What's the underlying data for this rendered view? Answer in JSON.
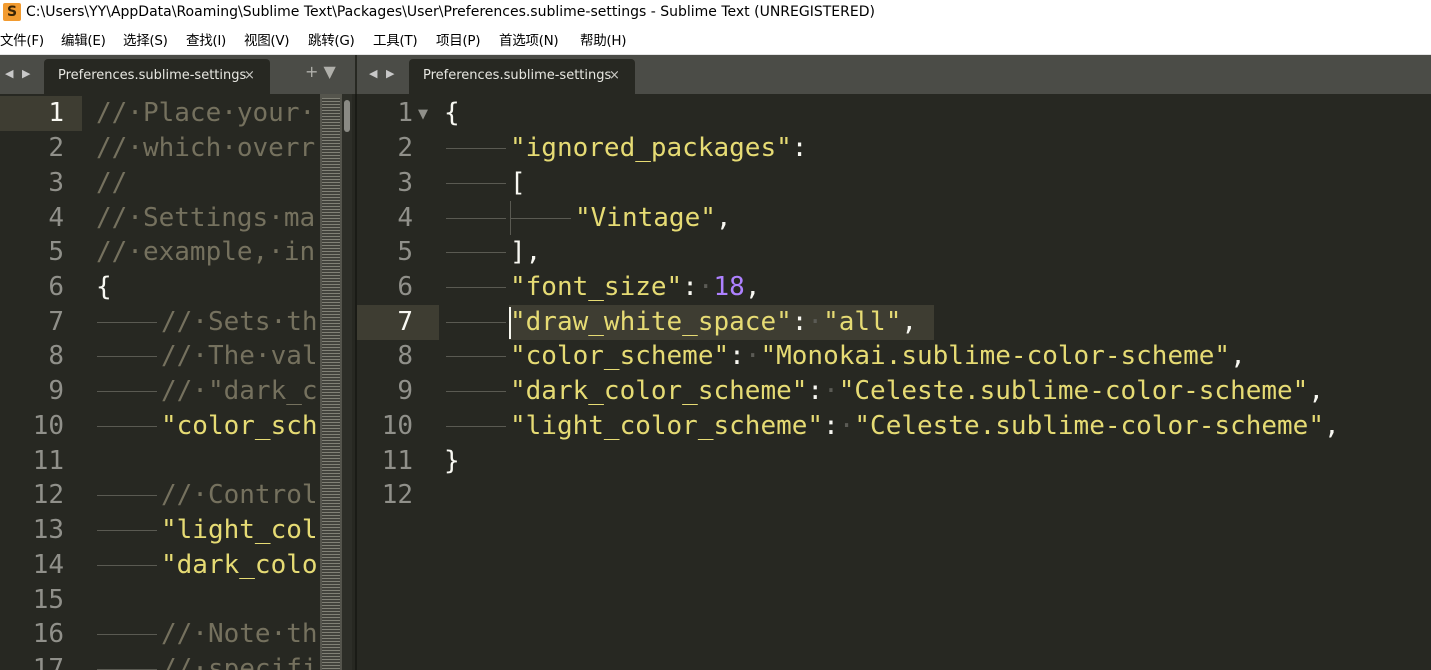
{
  "window": {
    "icon_letter": "S",
    "title": "C:\\Users\\YY\\AppData\\Roaming\\Sublime Text\\Packages\\User\\Preferences.sublime-settings - Sublime Text (UNREGISTERED)"
  },
  "menu": [
    "文件(F)",
    "编辑(E)",
    "选择(S)",
    "查找(I)",
    "视图(V)",
    "跳转(G)",
    "工具(T)",
    "项目(P)",
    "首选项(N)",
    "帮助(H)"
  ],
  "left_tab": {
    "label": "Preferences.sublime-settings",
    "close": "×",
    "tools": "+ ▼",
    "nav_back": "◀",
    "nav_fwd": "▶"
  },
  "right_tab": {
    "label": "Preferences.sublime-settings",
    "close": "×",
    "nav_back": "◀",
    "nav_fwd": "▶"
  },
  "left_pane": {
    "line_numbers": [
      "1",
      "2",
      "3",
      "4",
      "5",
      "6",
      "7",
      "8",
      "9",
      "10",
      "11",
      "12",
      "13",
      "14",
      "15",
      "16",
      "17"
    ],
    "lines": [
      "//·Place·your·",
      "//·which·overr",
      "//",
      "//·Settings·ma",
      "//·example,·in",
      "{",
      "//·Sets·th",
      "//·The·val",
      "//·\"dark_c",
      "\"color_sch",
      "",
      "//·Control",
      "\"light_col",
      "\"dark_colo",
      "",
      "//·Note·th",
      "//·specifi"
    ]
  },
  "right_pane": {
    "line_numbers": [
      "1",
      "2",
      "3",
      "4",
      "5",
      "6",
      "7",
      "8",
      "9",
      "10",
      "11",
      "12"
    ],
    "fold_marker": "▼",
    "code": {
      "l1_brace": "{",
      "l2_key": "\"ignored_packages\"",
      "l2_colon": ":",
      "l3_bracket": "[",
      "l4_val": "\"Vintage\"",
      "l4_comma": ",",
      "l5_close": "],",
      "l6_key": "\"font_size\"",
      "l6_colon": ":",
      "l6_ws": "·",
      "l6_val": "18",
      "l6_comma": ",",
      "l7_key": "\"draw_white_space\"",
      "l7_colon": ":",
      "l7_ws": "·",
      "l7_val": "\"all\"",
      "l7_comma": ",",
      "l8_key": "\"color_scheme\"",
      "l8_colon": ":",
      "l8_ws": "·",
      "l8_val": "\"Monokai.sublime-color-scheme\"",
      "l8_comma": ",",
      "l9_key": "\"dark_color_scheme\"",
      "l9_colon": ":",
      "l9_ws": "·",
      "l9_val": "\"Celeste.sublime-color-scheme\"",
      "l9_comma": ",",
      "l10_key": "\"light_color_scheme\"",
      "l10_colon": ":",
      "l10_ws": "·",
      "l10_val": "\"Celeste.sublime-color-scheme\"",
      "l10_comma": ",",
      "l11_brace": "}"
    }
  },
  "colors": {
    "background": "#272822",
    "comment": "#75715e",
    "string": "#e6db74",
    "number": "#ae81ff",
    "text": "#f8f8f2",
    "line_highlight": "#3e3d32",
    "tabbar": "#4b4c47"
  }
}
